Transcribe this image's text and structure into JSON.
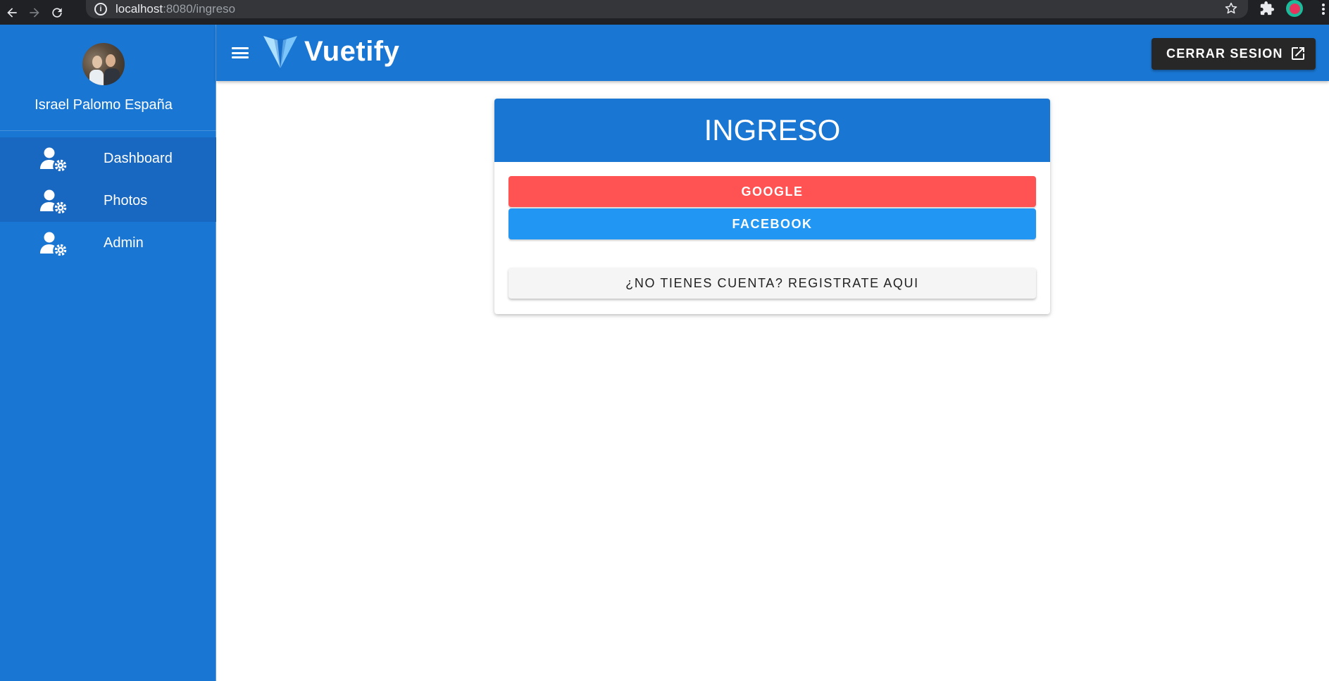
{
  "browser": {
    "url_host": "localhost",
    "url_path": ":8080/ingreso",
    "icons": [
      "back-icon",
      "forward-icon",
      "reload-icon",
      "info-icon",
      "star-icon",
      "extensions-icon",
      "profile-icon",
      "menu-kebab-icon"
    ]
  },
  "sidebar": {
    "user_name": "Israel Palomo España",
    "items": [
      {
        "label": "Dashboard",
        "icon": "user-cog-icon"
      },
      {
        "label": "Photos",
        "icon": "user-cog-icon"
      },
      {
        "label": "Admin",
        "icon": "user-cog-icon"
      }
    ]
  },
  "app_bar": {
    "brand": "Vuetify",
    "logout_label": "CERRAR SESION",
    "logout_icon": "open-in-new-icon"
  },
  "card": {
    "title": "INGRESO",
    "google_label": "GOOGLE",
    "facebook_label": "FACEBOOK",
    "register_label": "¿NO TIENES CUENTA? REGISTRATE AQUI"
  },
  "colors": {
    "primary": "#1976d2",
    "google": "#ff5252",
    "facebook": "#2196f3",
    "dark_button": "#272727"
  }
}
